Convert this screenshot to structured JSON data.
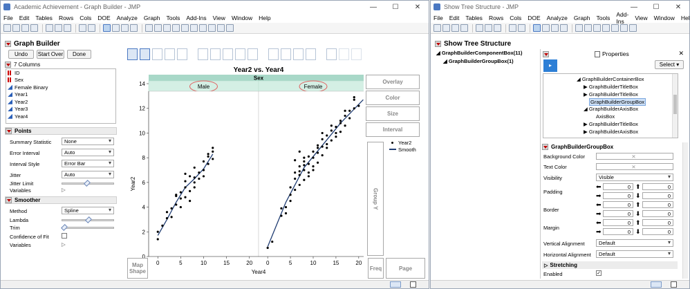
{
  "win1": {
    "title": "Academic Achievement - Graph Builder - JMP",
    "menu": [
      "File",
      "Edit",
      "Tables",
      "Rows",
      "Cols",
      "DOE",
      "Analyze",
      "Graph",
      "Tools",
      "Add-Ins",
      "View",
      "Window",
      "Help"
    ],
    "section_title": "Graph Builder",
    "buttons": {
      "undo": "Undo",
      "start_over": "Start Over",
      "done": "Done"
    },
    "columns_header": "7 Columns",
    "columns": [
      {
        "name": "ID",
        "type": "nominal"
      },
      {
        "name": "Sex",
        "type": "nominal"
      },
      {
        "name": "Female Binary",
        "type": "continuous"
      },
      {
        "name": "Year1",
        "type": "continuous"
      },
      {
        "name": "Year2",
        "type": "continuous"
      },
      {
        "name": "Year3",
        "type": "continuous"
      },
      {
        "name": "Year4",
        "type": "continuous"
      }
    ],
    "points_section": "Points",
    "points_props": [
      {
        "label": "Summary Statistic",
        "value": "None"
      },
      {
        "label": "Error Interval",
        "value": "Auto"
      },
      {
        "label": "Interval Style",
        "value": "Error Bar"
      },
      {
        "label": "Jitter",
        "value": "Auto"
      }
    ],
    "jitter_limit_label": "Jitter Limit",
    "variables_label": "Variables",
    "smoother_section": "Smoother",
    "method_label": "Method",
    "method_value": "Spline",
    "lambda_label": "Lambda",
    "trim_label": "Trim",
    "conf_label": "Confidence of Fit",
    "variables_label2": "Variables",
    "drop_zones": {
      "overlay": "Overlay",
      "color": "Color",
      "size": "Size",
      "interval": "Interval",
      "group_y": "Group Y",
      "freq": "Freq",
      "page": "Page",
      "map_shape": "Map Shape"
    },
    "legend": {
      "points": "Year2",
      "line": "Smooth"
    }
  },
  "chart_data": {
    "type": "scatter",
    "title": "Year2 vs. Year4",
    "group_title": "Sex",
    "panels": [
      {
        "name": "Male",
        "points": [
          [
            0,
            1.4
          ],
          [
            0,
            2.0
          ],
          [
            1,
            2.5
          ],
          [
            2,
            3.1
          ],
          [
            2,
            3.6
          ],
          [
            3,
            3.9
          ],
          [
            3,
            3.2
          ],
          [
            4,
            4.9
          ],
          [
            4,
            4.2
          ],
          [
            5,
            4.7
          ],
          [
            5,
            5.2
          ],
          [
            5,
            4.0
          ],
          [
            6,
            5.6
          ],
          [
            6,
            6.1
          ],
          [
            6,
            4.8
          ],
          [
            7,
            5.3
          ],
          [
            7,
            6.5
          ],
          [
            7,
            4.5
          ],
          [
            8,
            6.0
          ],
          [
            8,
            7.2
          ],
          [
            8,
            5.6
          ],
          [
            9,
            6.3
          ],
          [
            9,
            6.8
          ],
          [
            10,
            7.0
          ],
          [
            10,
            6.5
          ],
          [
            10,
            7.7
          ],
          [
            11,
            7.5
          ],
          [
            11,
            8.1
          ],
          [
            12,
            7.9
          ],
          [
            12,
            8.5
          ],
          [
            12,
            8.8
          ],
          [
            4,
            5.0
          ],
          [
            6,
            6.7
          ],
          [
            8,
            6.4
          ],
          [
            11,
            8.3
          ]
        ],
        "smooth": [
          [
            0,
            1.7
          ],
          [
            2,
            3.0
          ],
          [
            4,
            4.4
          ],
          [
            6,
            5.6
          ],
          [
            8,
            6.3
          ],
          [
            10,
            7.1
          ],
          [
            12,
            8.3
          ]
        ]
      },
      {
        "name": "Female",
        "points": [
          [
            0,
            0.7
          ],
          [
            1,
            1.2
          ],
          [
            3,
            3.3
          ],
          [
            3,
            3.9
          ],
          [
            4,
            3.5
          ],
          [
            5,
            4.5
          ],
          [
            5,
            5.0
          ],
          [
            6,
            5.4
          ],
          [
            6,
            6.3
          ],
          [
            7,
            5.8
          ],
          [
            7,
            6.6
          ],
          [
            7,
            7.3
          ],
          [
            8,
            6.2
          ],
          [
            8,
            7.0
          ],
          [
            8,
            7.7
          ],
          [
            9,
            6.8
          ],
          [
            9,
            7.5
          ],
          [
            9,
            8.1
          ],
          [
            10,
            7.3
          ],
          [
            10,
            8.0
          ],
          [
            10,
            7.0
          ],
          [
            11,
            8.4
          ],
          [
            11,
            9.0
          ],
          [
            11,
            7.6
          ],
          [
            12,
            8.2
          ],
          [
            12,
            8.9
          ],
          [
            12,
            9.5
          ],
          [
            13,
            9.1
          ],
          [
            13,
            9.8
          ],
          [
            14,
            9.4
          ],
          [
            14,
            10.2
          ],
          [
            15,
            9.7
          ],
          [
            15,
            10.5
          ],
          [
            16,
            10.1
          ],
          [
            16,
            10.8
          ],
          [
            17,
            10.6
          ],
          [
            17,
            11.4
          ],
          [
            18,
            11.2
          ],
          [
            18,
            11.8
          ],
          [
            19,
            12.0
          ],
          [
            19,
            12.7
          ],
          [
            20,
            12.2
          ],
          [
            6,
            7.8
          ],
          [
            7,
            8.5
          ],
          [
            8,
            8.0
          ],
          [
            10,
            8.5
          ],
          [
            12,
            10.0
          ],
          [
            14,
            10.6
          ],
          [
            16,
            11.0
          ],
          [
            9,
            6.5
          ],
          [
            11,
            8.8
          ],
          [
            13,
            8.8
          ],
          [
            15,
            10.0
          ],
          [
            17,
            11.8
          ],
          [
            19,
            12.9
          ],
          [
            5,
            5.6
          ],
          [
            7,
            6.9
          ],
          [
            4,
            4.0
          ],
          [
            6,
            6.8
          ],
          [
            8,
            7.4
          ]
        ],
        "smooth": [
          [
            0,
            0.8
          ],
          [
            4,
            4.4
          ],
          [
            8,
            7.2
          ],
          [
            12,
            9.0
          ],
          [
            16,
            10.8
          ],
          [
            21,
            12.7
          ]
        ]
      }
    ],
    "xlabel": "Year4",
    "ylabel": "Year2",
    "x_ticks": [
      "0",
      "5",
      "10",
      "15",
      "20"
    ],
    "y_ticks": [
      "0",
      "2",
      "4",
      "6",
      "8",
      "10",
      "12",
      "14"
    ],
    "xlim": [
      -2,
      22
    ],
    "ylim": [
      0,
      14
    ]
  },
  "win2": {
    "title": "Show Tree Structure - JMP",
    "menu": [
      "File",
      "Edit",
      "Tables",
      "Rows",
      "Cols",
      "DOE",
      "Analyze",
      "Graph",
      "Tools",
      "Add-Ins",
      "View",
      "Window",
      "Help"
    ],
    "section_title": "Show Tree Structure",
    "tree_root": "GraphBuilderComponentBox(11)",
    "tree_child": "GraphBuilderGroupBox(1)",
    "props_title": "Properties",
    "select_label": "Select",
    "tree_items": [
      "GraphBuilderContainerBox",
      "GraphBuilderTitleBox",
      "GraphBuilderTitleBox",
      "GraphBuilderGroupBox",
      "GraphBuilderAxisBox",
      "AxisBox",
      "GraphBuilderTitleBox",
      "GraphBuilderAxisBox"
    ],
    "prop_section": "GraphBuilderGroupBox",
    "bg_label": "Background Color",
    "text_label": "Text Color",
    "visibility_label": "Visibility",
    "visibility_value": "Visible",
    "padding_label": "Padding",
    "border_label": "Border",
    "margin_label": "Margin",
    "zero": "0",
    "valign_label": "Vertical Alignment",
    "valign_value": "Default",
    "halign_label": "Horizontal Alignment",
    "halign_value": "Default",
    "stretching_label": "Stretching",
    "enabled_label": "Enabled"
  }
}
